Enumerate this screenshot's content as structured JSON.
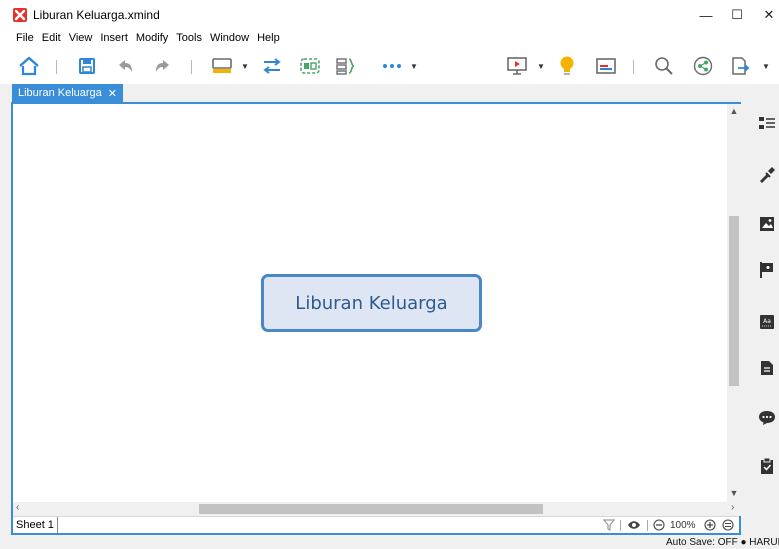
{
  "window": {
    "title": "Liburan Keluarga.xmind",
    "minimize_glyph": "—",
    "maximize_glyph": "☐",
    "close_glyph": "✕"
  },
  "menu": [
    "File",
    "Edit",
    "View",
    "Insert",
    "Modify",
    "Tools",
    "Window",
    "Help"
  ],
  "toolbar": {
    "icons": [
      "home-icon",
      "save-icon",
      "undo-icon",
      "redo-icon",
      "topic-icon",
      "relationship-icon",
      "boundary-icon",
      "summary-icon",
      "more-icon",
      "presentation-icon",
      "brainstorm-icon",
      "gantt-icon",
      "search-icon",
      "share-icon",
      "export-icon"
    ]
  },
  "tab": {
    "label": "Liburan Keluarga",
    "close_glyph": "✕"
  },
  "map": {
    "central_topic": "Liburan Keluarga"
  },
  "colors": {
    "accent": "#3a8ed8",
    "topic_fill": "#dde6f2",
    "topic_border": "#4a87c8",
    "topic_text": "#2e5b8f"
  },
  "sheetbar": {
    "sheet_name": "Sheet 1",
    "zoom": "100%"
  },
  "side_panel": {
    "icons": [
      "outline-icon",
      "format-icon",
      "image-icon",
      "marker-icon",
      "style-icon",
      "notes-icon",
      "comments-icon",
      "task-icon"
    ]
  },
  "status": {
    "text": "Auto Save: OFF  ●  HARUM"
  }
}
